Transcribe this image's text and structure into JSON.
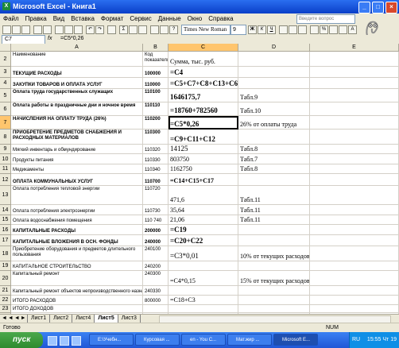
{
  "window": {
    "title": "Microsoft Excel - Книга1"
  },
  "menu": [
    "Файл",
    "Правка",
    "Вид",
    "Вставка",
    "Формат",
    "Сервис",
    "Данные",
    "Окно",
    "Справка"
  ],
  "help_placeholder": "Введите вопрос",
  "toolbar": {
    "font": "Times New Roman",
    "size": "9"
  },
  "formula_bar": {
    "cell": "C7",
    "fx": "fx",
    "formula": "=C5*0,26"
  },
  "columns": [
    "A",
    "B",
    "C",
    "D",
    "E"
  ],
  "rows": [
    {
      "n": "2",
      "a": "Наименование",
      "b": "Код показателя",
      "c": "Сумма, тыс. руб.",
      "d": "",
      "style": "hdr"
    },
    {
      "n": "3",
      "a": "ТЕКУЩИЕ РАСХОДЫ",
      "b": "100000",
      "c": "=C4",
      "d": "",
      "style": "bold"
    },
    {
      "n": "4",
      "a": "ЗАКУПКИ ТОВАРОВ И ОПЛАТА УСЛУГ",
      "b": "110000",
      "c": "=C5+C7+C8+C13+C6",
      "d": "",
      "style": "bold"
    },
    {
      "n": "5",
      "a": "Оплата труда государственных служащих",
      "b": "110100",
      "c": "1646175,7",
      "d": "Табл.9",
      "style": "bold"
    },
    {
      "n": "6",
      "a": "Оплата работы в праздничные дни и ночное время",
      "b": "110110",
      "c": "=18760+782560",
      "d": "Табл.10",
      "style": "bold"
    },
    {
      "n": "7",
      "a": "НАЧИСЛЕНИЯ НА ОПЛАТУ ТРУДА (26%)",
      "b": "110200",
      "c": "=C5*0,26",
      "d": "26% от оплаты труда",
      "style": "bold"
    },
    {
      "n": "8",
      "a": "ПРИОБРЕТЕНИЕ ПРЕДМЕТОВ СНАБЖЕНИЯ И РАСХОДНЫХ МАТЕРИАЛОВ",
      "b": "110300",
      "c": "=C9+C11+C12",
      "d": "",
      "style": "bold"
    },
    {
      "n": "9",
      "a": "Мягкий инвентарь и обмундирование",
      "b": "110320",
      "c": "14125",
      "d": "Табл.8",
      "style": "normal"
    },
    {
      "n": "10",
      "a": "Продукты питания",
      "b": "110330",
      "c": "803750",
      "d": "Табл.7",
      "style": "normal"
    },
    {
      "n": "11",
      "a": "Медикаменты",
      "b": "110340",
      "c": "1162750",
      "d": "Табл.8",
      "style": "normal"
    },
    {
      "n": "12",
      "a": "ОПЛАТА КОММУНАЛЬНЫХ УСЛУГ",
      "b": "110700",
      "c": "=C14+C15+C17",
      "d": "",
      "style": "bold"
    },
    {
      "n": "13",
      "a": "Оплата потребления тепловой энергии",
      "b": "110720",
      "c": "471,6",
      "d": "Табл.11",
      "style": "normal"
    },
    {
      "n": "14",
      "a": "Оплата потребления электроэнергии",
      "b": "110730",
      "c": "35,64",
      "d": "Табл.11",
      "style": "normal"
    },
    {
      "n": "15",
      "a": "Оплата водоснабжения помещения",
      "b": "110 740",
      "c": "21,06",
      "d": "Табл.11",
      "style": "normal"
    },
    {
      "n": "16",
      "a": "КАПИТАЛЬНЫЕ РАСХОДЫ",
      "b": "200000",
      "c": "=C19",
      "d": "",
      "style": "bold"
    },
    {
      "n": "17",
      "a": "КАПИТАЛЬНЫЕ ВЛОЖЕНИЯ В ОСН. ФОНДЫ",
      "b": "240000",
      "c": "=C20+C22",
      "d": "",
      "style": "bold"
    },
    {
      "n": "18",
      "a": "Приобретение оборудования и предметов длительного пользования",
      "b": "240100",
      "c": "=C3*0,01",
      "d": "10% от текущих расходов",
      "style": "normal"
    },
    {
      "n": "19",
      "a": "КАПИТАЛЬНОЕ СТРОИТЕЛЬСТВО",
      "b": "240200",
      "c": "",
      "d": "",
      "style": "normal"
    },
    {
      "n": "20",
      "a": "Капитальный ремонт",
      "b": "240300",
      "c": "=C4*0,15",
      "d": "15% от текущих расходов",
      "style": "normal"
    },
    {
      "n": "21",
      "a": "Капитальный ремонт объектов непроизводственного назначения",
      "b": "240330",
      "c": "",
      "d": "",
      "style": "normal"
    },
    {
      "n": "22",
      "a": "ИТОГО РАСХОДОВ",
      "b": "800000",
      "c": "=C18+C3",
      "d": "",
      "style": "normal"
    },
    {
      "n": "23",
      "a": "ИТОГО ДОХОДОВ",
      "b": "",
      "c": "",
      "d": "",
      "style": "normal"
    },
    {
      "n": "24",
      "a": "",
      "b": "",
      "c": "",
      "d": "",
      "style": "normal"
    },
    {
      "n": "25",
      "a": "",
      "b": "",
      "c": "",
      "d": "",
      "style": "normal"
    },
    {
      "n": "26",
      "a": "",
      "b": "",
      "c": "",
      "d": "",
      "style": "normal"
    }
  ],
  "sheets": [
    "Лист1",
    "Лист2",
    "Лист4",
    "Лист5",
    "Лист3"
  ],
  "active_sheet": "Лист5",
  "status": {
    "left": "Готово",
    "num": "NUM"
  },
  "taskbar": {
    "start": "пуск",
    "tasks": [
      "Е:\\Учебн...",
      "Курсовая ...",
      "en - You C...",
      "Мат.жир ...",
      "Microsoft E..."
    ],
    "lang": "RU",
    "time": "15:55 Чт 19"
  }
}
